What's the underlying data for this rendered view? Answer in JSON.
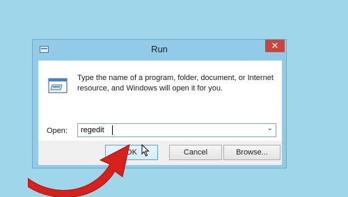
{
  "dialog": {
    "title": "Run",
    "close_symbol": "✕",
    "description": "Type the name of a program, folder, document, or Internet resource, and Windows will open it for you.",
    "open_label": "Open:",
    "open_value": "regedit",
    "dropdown_symbol": "⌄"
  },
  "buttons": {
    "ok": "OK",
    "cancel": "Cancel",
    "browse": "Browse..."
  },
  "icons": [
    "run-title-icon",
    "run-icon",
    "close-icon",
    "chevron-down-icon",
    "mouse-cursor-icon",
    "red-arrow-icon"
  ],
  "colors": {
    "background": "#9fd6e9",
    "close_button": "#c9463d",
    "arrow": "#d8201c"
  }
}
